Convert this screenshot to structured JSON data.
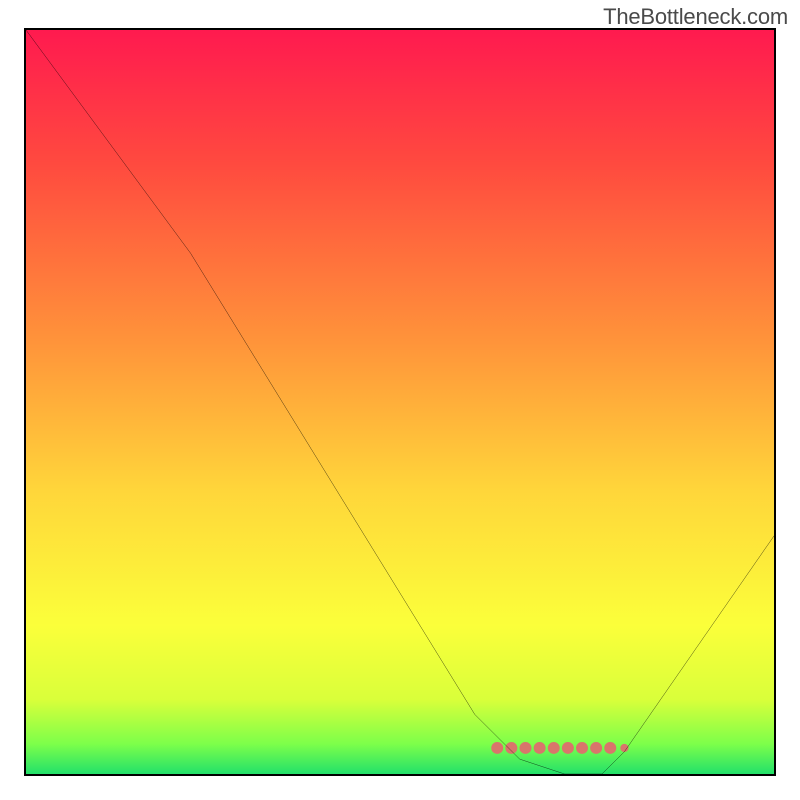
{
  "watermark": "TheBottleneck.com",
  "chart_data": {
    "type": "line",
    "title": "",
    "xlabel": "",
    "ylabel": "",
    "xlim": [
      0,
      100
    ],
    "ylim": [
      0,
      100
    ],
    "grid": false,
    "legend": false,
    "series": [
      {
        "name": "curve",
        "x": [
          0,
          22,
          60,
          66,
          72,
          77,
          80,
          100
        ],
        "values": [
          100,
          70,
          8,
          2,
          0,
          0,
          3,
          32
        ]
      }
    ],
    "marker_span": {
      "name": "band",
      "x_start": 63,
      "x_end": 80,
      "y": 3.5,
      "color": "#d9756b"
    },
    "gradient_stops": [
      {
        "offset": 0.0,
        "color": "#ff1a4f"
      },
      {
        "offset": 0.18,
        "color": "#ff4a3f"
      },
      {
        "offset": 0.42,
        "color": "#ff943a"
      },
      {
        "offset": 0.62,
        "color": "#ffd63a"
      },
      {
        "offset": 0.8,
        "color": "#fbff3a"
      },
      {
        "offset": 0.9,
        "color": "#d9ff3a"
      },
      {
        "offset": 0.96,
        "color": "#7cff4a"
      },
      {
        "offset": 1.0,
        "color": "#22e06a"
      }
    ]
  }
}
